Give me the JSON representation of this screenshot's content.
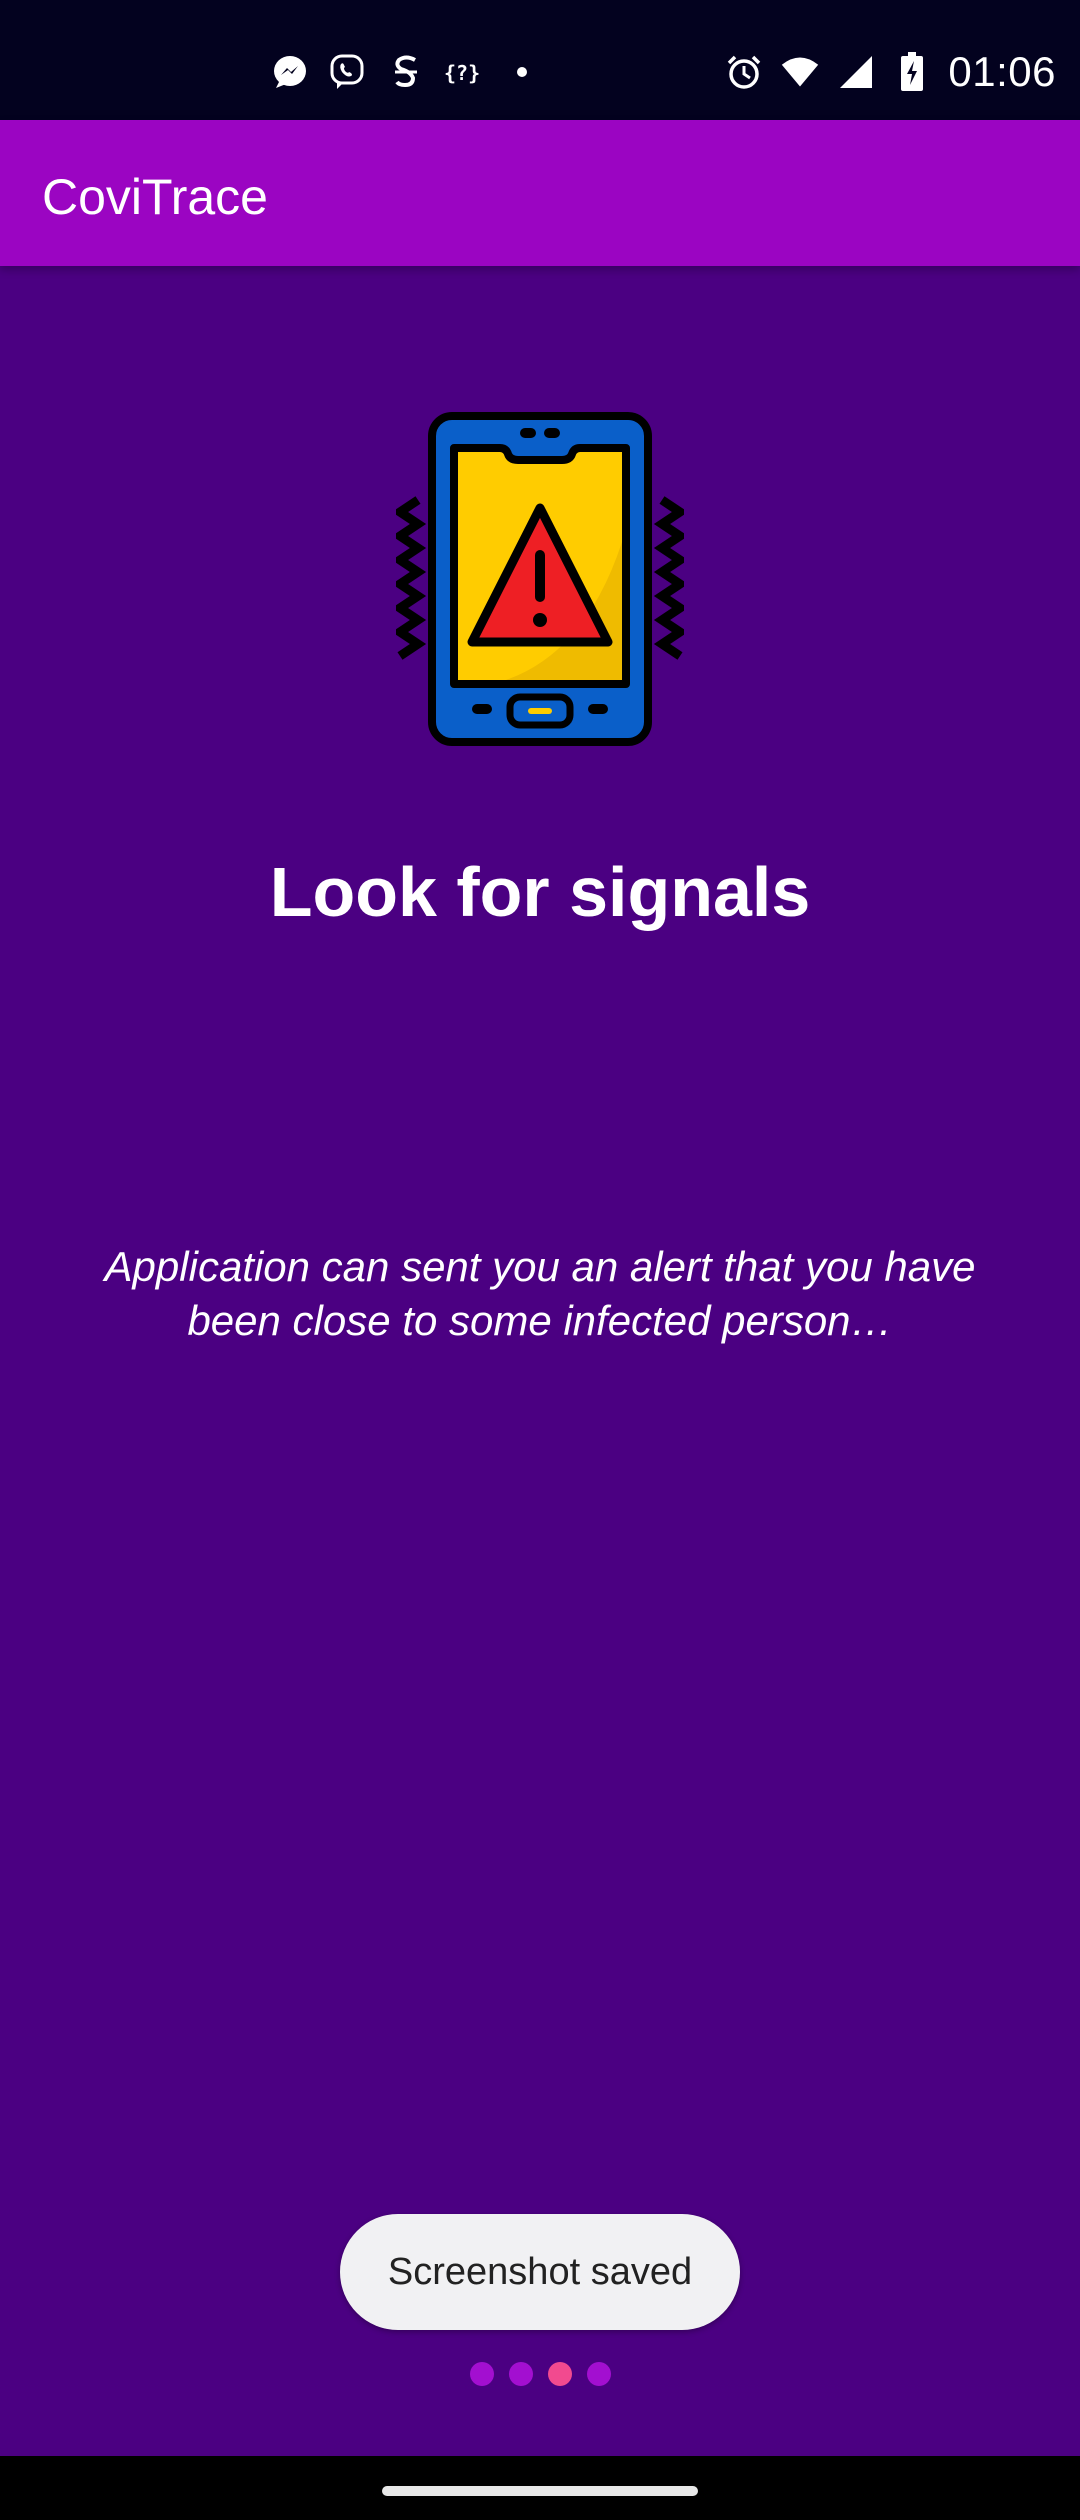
{
  "status_bar": {
    "time": "01:06",
    "notification_icons": [
      "messenger-icon",
      "viber-icon",
      "scribd-icon",
      "json-icon",
      "dot-icon"
    ],
    "system_icons": [
      "alarm-icon",
      "wifi-icon",
      "signal-icon",
      "battery-charging-icon"
    ]
  },
  "app_bar": {
    "title": "CoviTrace"
  },
  "onboarding": {
    "illustration": "phone-warning-icon",
    "headline": "Look for signals",
    "description": "Application can sent you an alert that you have been close to some infected person…"
  },
  "toast": {
    "message": "Screenshot saved"
  },
  "pager": {
    "total_pages": 4,
    "active_page": 3
  },
  "colors": {
    "status_bar": "#03021f",
    "app_bar": "#9b05c2",
    "background": "#4b0082",
    "dot": "#a30fd0",
    "dot_active": "#f24a8f",
    "phone_body": "#0a5fc9",
    "phone_screen": "#ffcc00",
    "warning_red": "#ee1f24"
  }
}
